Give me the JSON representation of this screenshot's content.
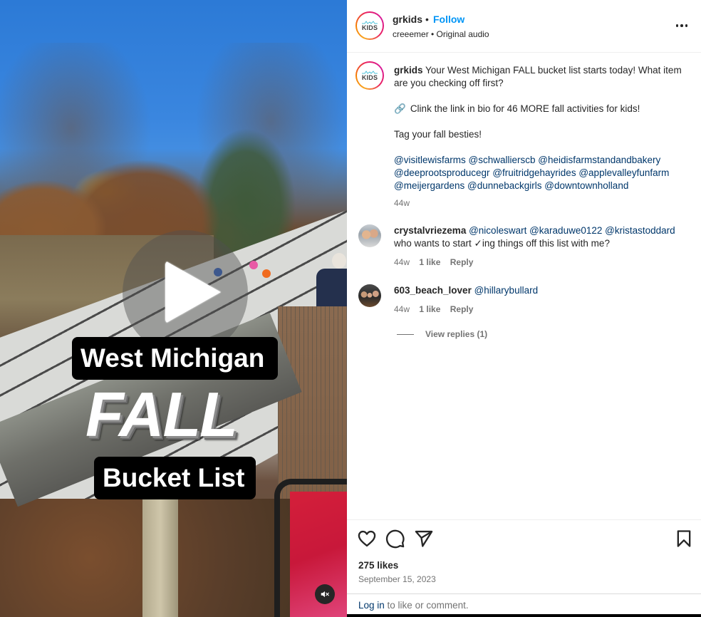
{
  "video": {
    "caption_line1": "West Michigan",
    "caption_line2": "FALL",
    "caption_line3": "Bucket List",
    "play_icon": "play-icon",
    "mute_icon": "speaker-muted-icon",
    "muted": true
  },
  "header": {
    "avatar_text": "KIDS",
    "username": "grkids",
    "separator": "•",
    "follow_label": "Follow",
    "audio_line": "creeemer • Original audio",
    "more_icon": "more-options-icon"
  },
  "caption": {
    "username": "grkids",
    "text": "Your West Michigan FALL bucket list starts today! What item are you checking off first?",
    "link_line": "Clink the link in bio for 46 MORE fall activities for kids!",
    "tag_line": "Tag your fall besties!",
    "mentions": [
      "@visitlewisfarms",
      "@schwallierscb",
      "@heidisfarmstandandbakery",
      "@deeprootsproducegr",
      "@fruitridgehayrides",
      "@applevalleyfunfarm",
      "@meijergardens",
      "@dunnebackgirls",
      "@downtownholland"
    ],
    "time": "44w"
  },
  "comments": [
    {
      "username": "crystalvriezema",
      "mentions": [
        "@nicoleswart",
        "@karaduwe0122",
        "@kristastoddard"
      ],
      "text": "who wants to start ✓ing things off this list with me?",
      "time": "44w",
      "likes": "1 like",
      "reply_label": "Reply"
    },
    {
      "username": "603_beach_lover",
      "mentions": [
        "@hillarybullard"
      ],
      "text": "",
      "time": "44w",
      "likes": "1 like",
      "reply_label": "Reply",
      "view_replies": "View replies (1)"
    }
  ],
  "actions": {
    "like_icon": "heart-icon",
    "comment_icon": "comment-icon",
    "share_icon": "share-icon",
    "save_icon": "bookmark-icon"
  },
  "stats": {
    "likes": "275 likes",
    "date": "September 15, 2023"
  },
  "login": {
    "link_label": "Log in",
    "suffix": " to like or comment."
  },
  "colors": {
    "follow_blue": "#0095f6",
    "mention_blue": "#00376b",
    "muted_gray": "#737373",
    "text": "#262626"
  }
}
